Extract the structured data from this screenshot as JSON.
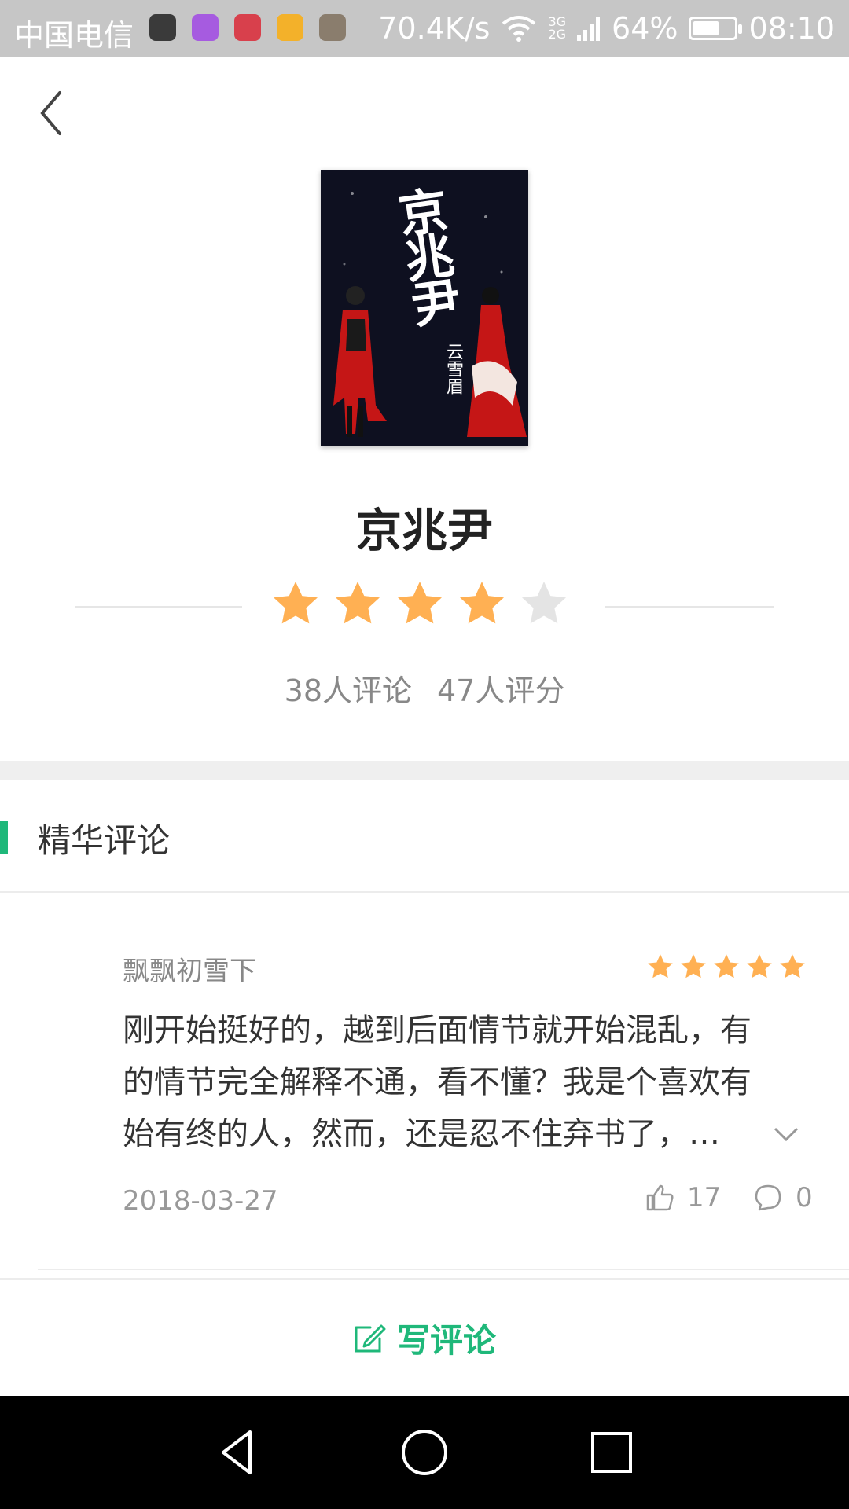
{
  "status_bar": {
    "carrier": "中国电信",
    "net_speed": "70.4K/s",
    "network_type_top": "3G",
    "network_type_bottom": "2G",
    "battery_percent": "64%",
    "battery_level": 0.64,
    "time": "08:10"
  },
  "book": {
    "title": "京兆尹",
    "cover_title": "京兆尹",
    "cover_author": "云雪眉",
    "rating_stars": 4,
    "rating_max": 5,
    "comment_count_text": "38人评论",
    "rating_count_text": "47人评分"
  },
  "featured": {
    "title": "精华评论"
  },
  "reviews": [
    {
      "user": "飘飘初雪下",
      "stars": 5,
      "text_lines": [
        "刚开始挺好的，越到后面情节就开始混乱，有",
        "的情节完全解释不通，看不懂？我是个喜欢有",
        "始有终的人，然而，还是忍不住弃书了，…"
      ],
      "date": "2018-03-27",
      "likes": "17",
      "comments": "0"
    }
  ],
  "actions": {
    "write_review_label": "写评论"
  },
  "colors": {
    "accent_green": "#1fb87a",
    "star_orange": "#ffb053",
    "star_empty": "#e4e4e4"
  },
  "icons": {
    "back": "back-arrow-icon",
    "edit": "edit-icon",
    "like": "thumb-up-icon",
    "comment": "comment-bubble-icon",
    "expand": "chevron-down-icon"
  }
}
